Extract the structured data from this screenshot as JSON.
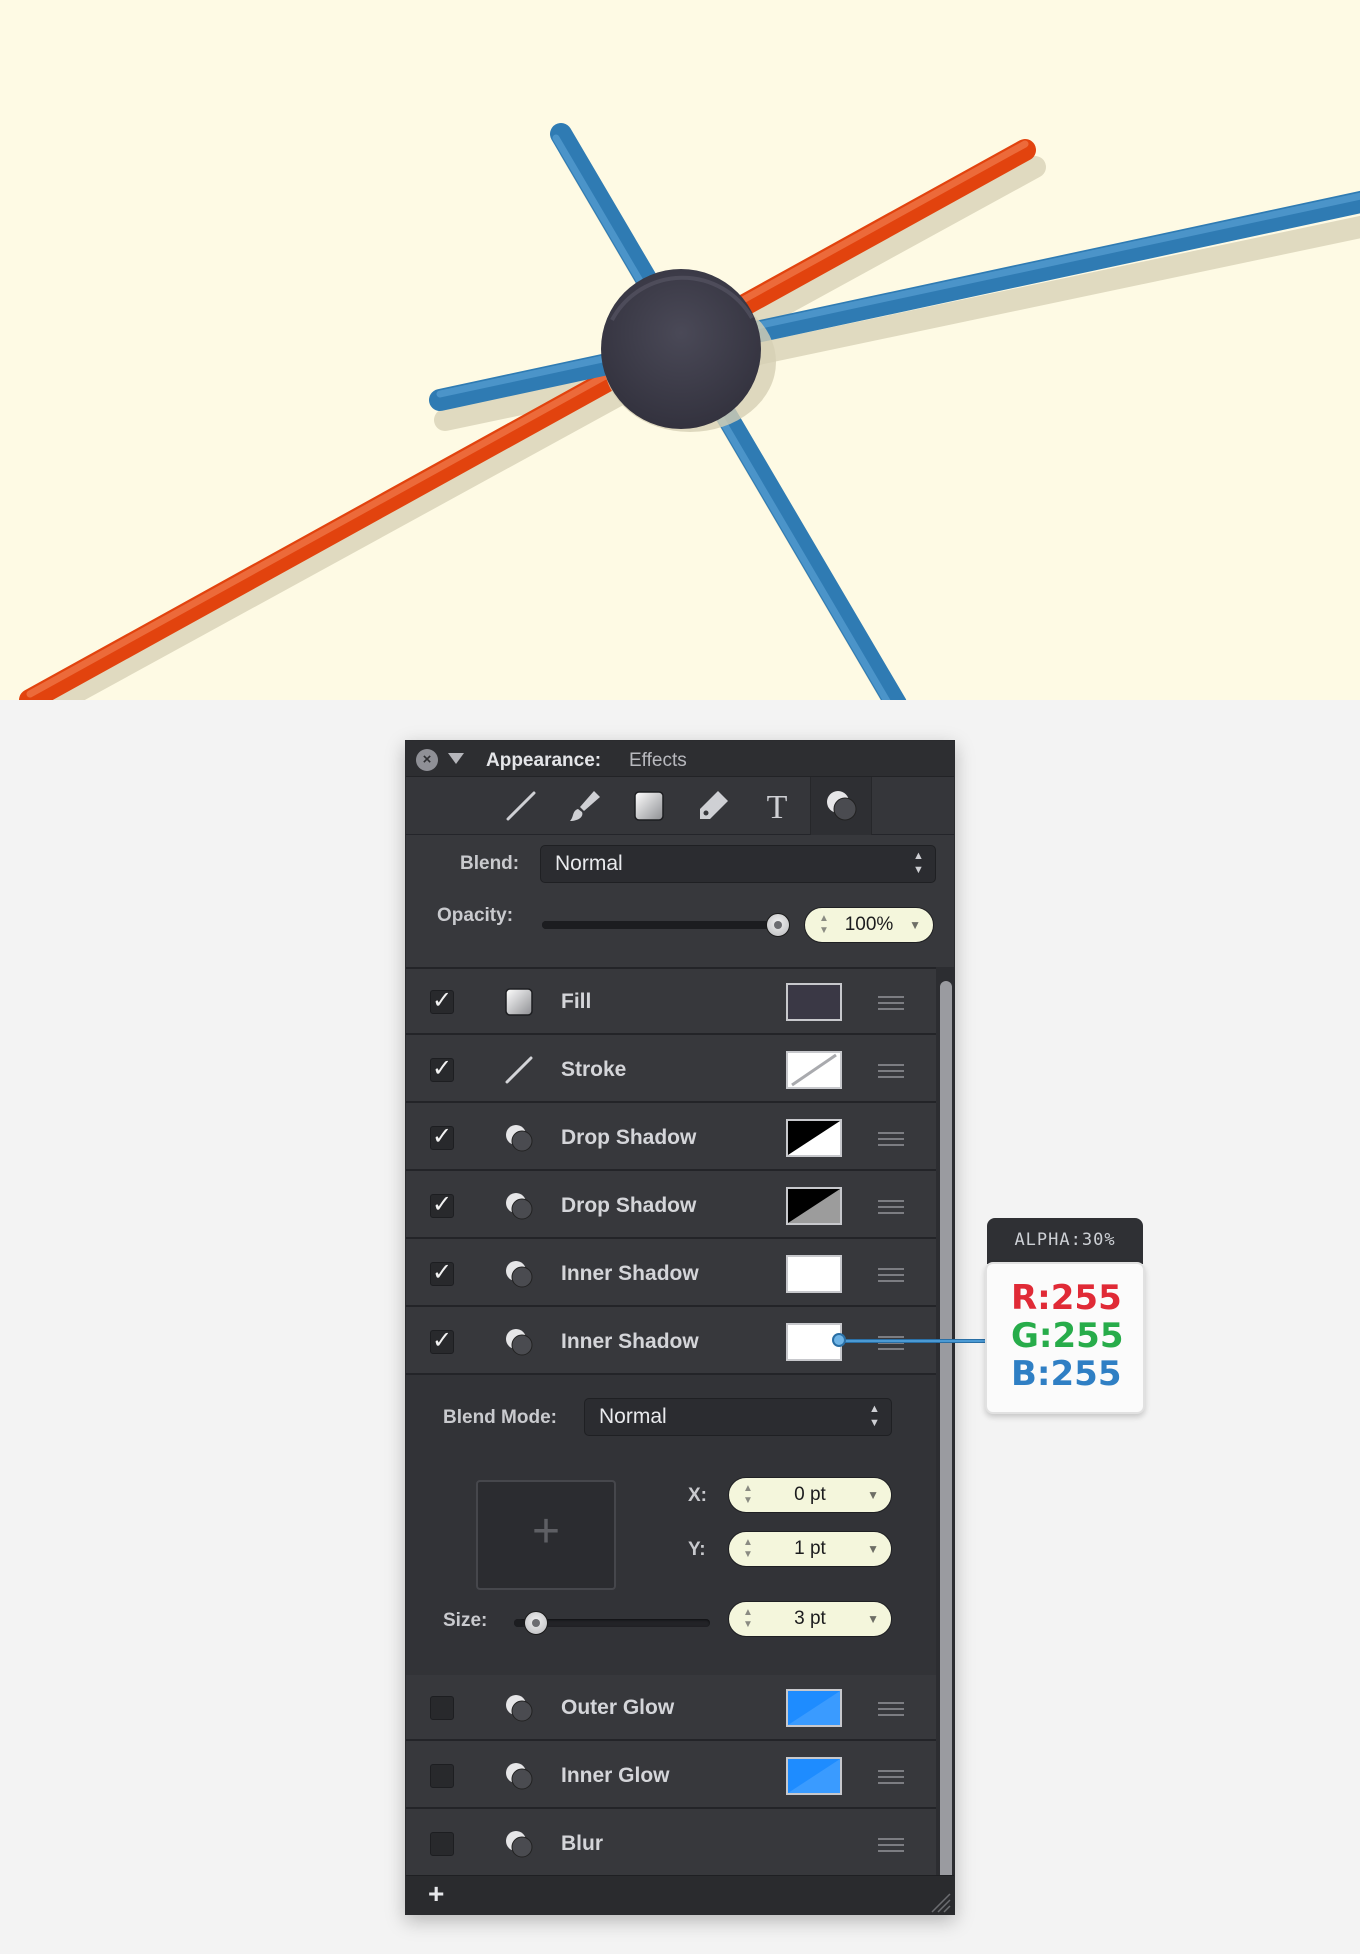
{
  "panel": {
    "title": "Appearance:",
    "subtitle": "Effects",
    "close_glyph": "×",
    "toolbar_icons": [
      "stroke-tool-icon",
      "brush-tool-icon",
      "fill-tool-icon",
      "pencil-tool-icon",
      "text-tool-icon",
      "effects-tool-icon"
    ],
    "text_tool_glyph": "T",
    "blend_label": "Blend:",
    "blend_value": "Normal",
    "opacity_label": "Opacity:",
    "opacity_value": "100%",
    "opacity_level": 1.0
  },
  "effects": [
    {
      "checked": true,
      "icon": "fill-icon",
      "name": "Fill",
      "swatch": "fill-dark",
      "color": "#3a3845"
    },
    {
      "checked": true,
      "icon": "stroke-icon",
      "name": "Stroke",
      "swatch": "none",
      "color": "#ffffff"
    },
    {
      "checked": true,
      "icon": "effect-icon",
      "name": "Drop Shadow",
      "swatch": "black-split",
      "color": "#000000"
    },
    {
      "checked": true,
      "icon": "effect-icon",
      "name": "Drop Shadow",
      "swatch": "black-split-gray",
      "color": "#000000"
    },
    {
      "checked": true,
      "icon": "effect-icon",
      "name": "Inner Shadow",
      "swatch": "white",
      "color": "#ffffff"
    },
    {
      "checked": true,
      "icon": "effect-icon",
      "name": "Inner Shadow",
      "swatch": "white",
      "color": "#ffffff"
    },
    {
      "checked": false,
      "icon": "effect-icon",
      "name": "Outer Glow",
      "swatch": "blue-split",
      "color": "#1e8cff"
    },
    {
      "checked": false,
      "icon": "effect-icon",
      "name": "Inner Glow",
      "swatch": "blue-split",
      "color": "#1e8cff"
    },
    {
      "checked": false,
      "icon": "effect-icon",
      "name": "Blur",
      "swatch": "",
      "color": ""
    }
  ],
  "detail": {
    "blend_mode_label": "Blend Mode:",
    "blend_mode_value": "Normal",
    "x_label": "X:",
    "x_value": "0 pt",
    "y_label": "Y:",
    "y_value": "1 pt",
    "size_label": "Size:",
    "size_value": "3 pt",
    "size_level": 0.05,
    "preview_glyph": "+"
  },
  "bottom": {
    "add_glyph": "+"
  },
  "callout": {
    "alpha": "ALPHA:30%",
    "r": "R:255",
    "g": "G:255",
    "b": "B:255"
  },
  "artwork": {
    "background": "#fefae4",
    "blue": "#2f7bb3",
    "orange": "#e2430e",
    "knob": "#3f3e4b"
  },
  "colors": {
    "panel_bg": "#37383c",
    "stepper_bg": "#f4f6dc",
    "callout_line": "#4b9ad4"
  }
}
